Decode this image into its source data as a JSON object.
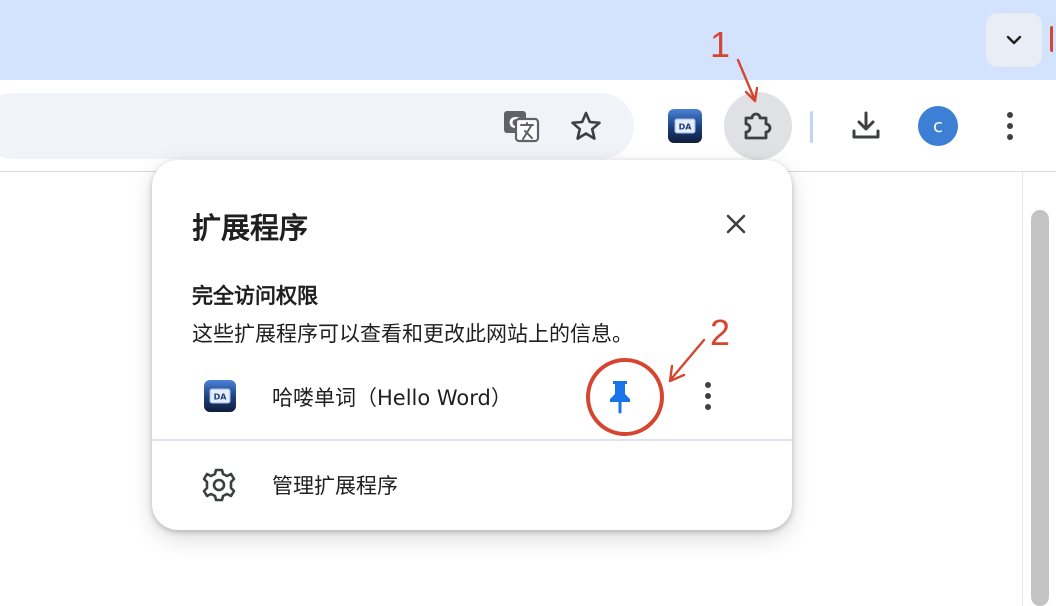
{
  "popup": {
    "title": "扩展程序",
    "section_title": "完全访问权限",
    "section_desc": "这些扩展程序可以查看和更改此网站上的信息。",
    "extension_name": "哈喽单词（Hello Word）",
    "manage_label": "管理扩展程序"
  },
  "toolbar": {
    "avatar_letter": "c"
  },
  "annotations": {
    "step1": "1",
    "step2": "2",
    "color": "#d6452f"
  },
  "colors": {
    "tabstrip_bg": "#d3e3fd",
    "pin_active": "#1a73e8",
    "avatar_bg": "#3c7fd5"
  },
  "icons": {
    "translate": "translate-icon",
    "star": "bookmark-star-icon",
    "puzzle": "extensions-puzzle-icon",
    "download": "download-icon",
    "menu": "more-vert-icon",
    "close": "close-icon",
    "pin": "pin-icon",
    "gear": "gear-icon"
  }
}
